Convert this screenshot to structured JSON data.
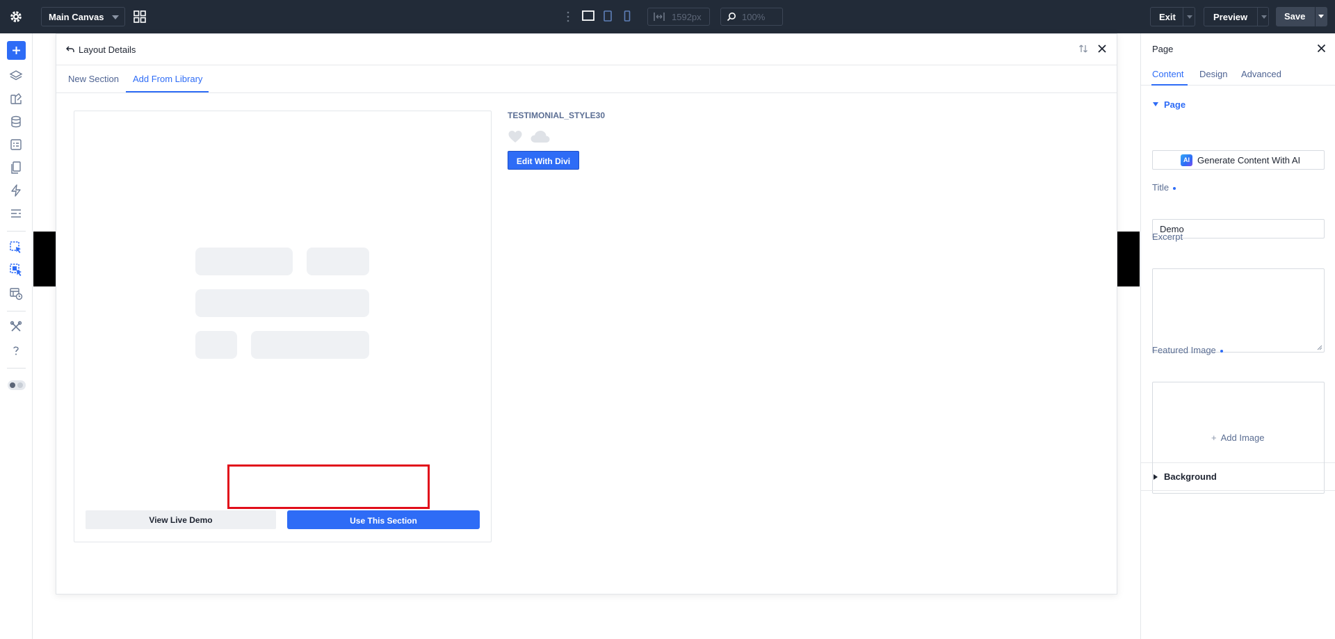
{
  "topbar": {
    "canvas_select": "Main Canvas",
    "width_value": "1592px",
    "zoom_value": "100%",
    "exit_label": "Exit",
    "preview_label": "Preview",
    "save_label": "Save"
  },
  "modal": {
    "title": "Layout Details",
    "tabs": [
      {
        "label": "New Section"
      },
      {
        "label": "Add From Library"
      }
    ],
    "active_tab": "Add From Library",
    "layout_name": "TESTIMONIAL_STYLE30",
    "edit_button": "Edit With Divi",
    "view_demo_button": "View Live Demo",
    "use_section_button": "Use This Section"
  },
  "right_panel": {
    "title": "Page",
    "tabs": [
      {
        "label": "Content"
      },
      {
        "label": "Design"
      },
      {
        "label": "Advanced"
      }
    ],
    "active_tab": "Content",
    "section_label": "Page",
    "ai_badge": "AI",
    "ai_button": "Generate Content With AI",
    "title_label": "Title",
    "title_value": "Demo",
    "excerpt_label": "Excerpt",
    "featured_image_label": "Featured Image",
    "add_image": "Add Image",
    "background_label": "Background"
  },
  "colors": {
    "accent": "#2e6cf6",
    "topbar_bg": "#222b38",
    "highlight": "#e10e1a"
  },
  "icons": {
    "sidebar": [
      "add-icon",
      "layers-icon",
      "theme-builder-icon",
      "database-icon",
      "page-settings-icon",
      "pages-icon",
      "bolt-icon",
      "list-icon",
      "pick-icon",
      "library-pick-icon",
      "layout-history-icon",
      "tools-icon",
      "help-icon",
      "theme-toggle"
    ]
  }
}
